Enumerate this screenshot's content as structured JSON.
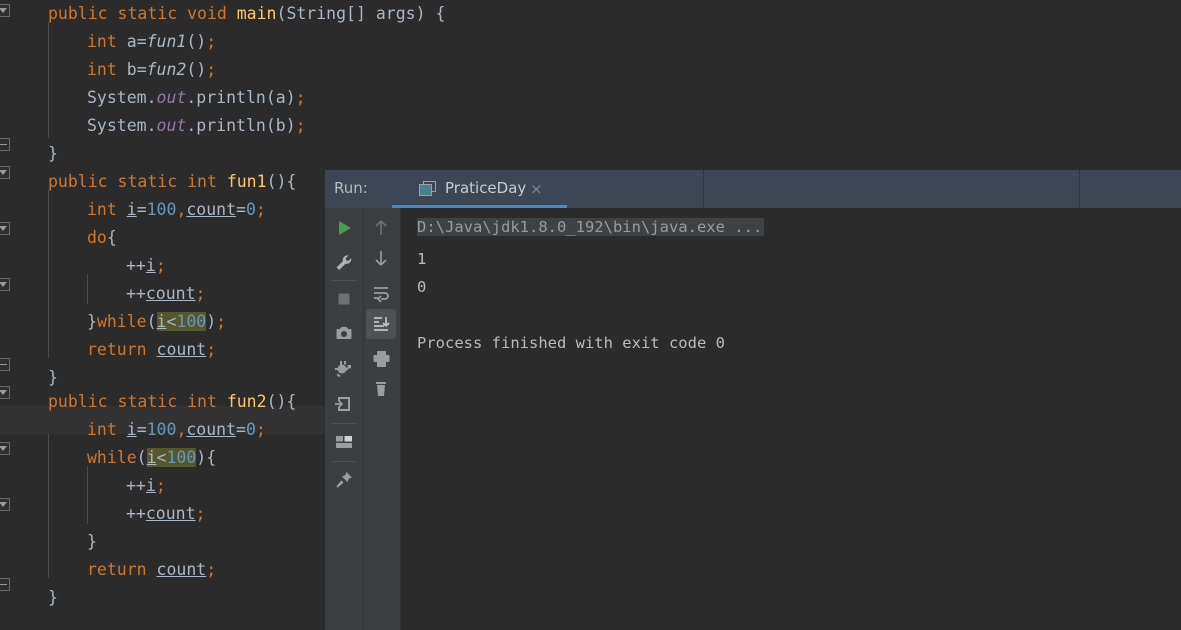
{
  "editor": {
    "background": "#2b2b2b",
    "current_line_background": "#323232",
    "search_highlight_color": "#56562f",
    "lines": [
      "public static void main(String[] args) {",
      "    int a=fun1();",
      "    int b=fun2();",
      "    System.out.println(a);",
      "    System.out.println(b);",
      "}",
      "public static int fun1(){",
      "    int i=100,count=0;",
      "    do{",
      "        ++i;",
      "        ++count;",
      "    }while(i<100);",
      "    return count;",
      "}",
      "public static int fun2(){",
      "    int i=100,count=0;",
      "    while(i<100){",
      "        ++i;",
      "        ++count;",
      "    }",
      "    return count;",
      "}"
    ]
  },
  "run_panel": {
    "label": "Run:",
    "tab_title": "PraticeDay",
    "tab_close": "×",
    "tab_icon_name": "run-configuration-icon",
    "accent": "#4a88c7",
    "header_background": "#3c4654",
    "toolbar_left": [
      {
        "name": "rerun-button",
        "icon": "play-icon",
        "title": "Rerun"
      },
      {
        "name": "settings-button",
        "icon": "wrench-icon",
        "title": "Edit configuration"
      },
      {
        "name": "stop-button",
        "icon": "stop-icon",
        "title": "Stop"
      },
      {
        "name": "screenshot-button",
        "icon": "camera-icon",
        "title": "Capture"
      },
      {
        "name": "debug-attach-button",
        "icon": "bug-icon",
        "title": "Attach debugger"
      },
      {
        "name": "export-button",
        "icon": "import-arrow-icon",
        "title": "Export"
      },
      {
        "name": "layout-button",
        "icon": "layout-icon",
        "title": "Layout"
      },
      {
        "name": "pin-button",
        "icon": "pin-icon",
        "title": "Pin tab"
      }
    ],
    "toolbar_right": [
      {
        "name": "prev-occurrence-button",
        "icon": "arrow-up-icon",
        "title": "Up"
      },
      {
        "name": "next-occurrence-button",
        "icon": "arrow-down-icon",
        "title": "Down"
      },
      {
        "name": "soft-wrap-button",
        "icon": "soft-wrap-icon",
        "title": "Soft-Wrap"
      },
      {
        "name": "scroll-to-end-button",
        "icon": "scroll-to-end-icon",
        "title": "Scroll to end",
        "selected": true
      },
      {
        "name": "print-button",
        "icon": "printer-icon",
        "title": "Print"
      },
      {
        "name": "clear-all-button",
        "icon": "trash-icon",
        "title": "Clear All"
      }
    ],
    "console": {
      "command_line": "D:\\Java\\jdk1.8.0_192\\bin\\java.exe ...",
      "output": [
        "1",
        "0"
      ],
      "exit_message": "Process finished with exit code 0"
    }
  }
}
